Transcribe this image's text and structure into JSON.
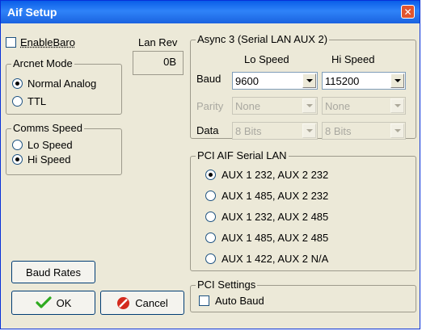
{
  "window": {
    "title": "Aif Setup",
    "close_glyph": "✕"
  },
  "enable_baro": {
    "label": "EnableBaro",
    "checked": false
  },
  "lan_rev": {
    "label": "Lan Rev",
    "value": "0B"
  },
  "arcnet_mode": {
    "legend": "Arcnet Mode",
    "options": [
      {
        "label": "Normal Analog",
        "checked": true
      },
      {
        "label": "TTL",
        "checked": false
      }
    ]
  },
  "comms_speed": {
    "legend": "Comms Speed",
    "options": [
      {
        "label": "Lo Speed",
        "checked": false
      },
      {
        "label": "Hi Speed",
        "checked": true
      }
    ]
  },
  "async3": {
    "legend": "Async 3 (Serial LAN AUX 2)",
    "lo_header": "Lo Speed",
    "hi_header": "Hi Speed",
    "baud": {
      "label": "Baud",
      "lo": "9600",
      "hi": "115200"
    },
    "parity": {
      "label": "Parity",
      "lo": "None",
      "hi": "None"
    },
    "data": {
      "label": "Data",
      "lo": "8 Bits",
      "hi": "8 Bits"
    }
  },
  "pci_aif": {
    "legend": "PCI AIF Serial LAN",
    "options": [
      {
        "label": "AUX 1 232, AUX 2 232",
        "checked": true
      },
      {
        "label": "AUX 1 485, AUX 2 232",
        "checked": false
      },
      {
        "label": "AUX 1 232, AUX 2 485",
        "checked": false
      },
      {
        "label": "AUX 1 485, AUX 2 485",
        "checked": false
      },
      {
        "label": "AUX 1 422, AUX 2 N/A",
        "checked": false
      }
    ]
  },
  "pci_settings": {
    "legend": "PCI Settings",
    "auto_baud": {
      "label": "Auto Baud",
      "checked": false
    }
  },
  "buttons": {
    "baud_rates": "Baud Rates",
    "ok": "OK",
    "cancel": "Cancel"
  },
  "colors": {
    "title_bar": "#0a5ee8",
    "close_button": "#e0552f",
    "dialog_bg": "#ece9d8",
    "ok_check": "#2eaa1f",
    "cancel_icon": "#d42a1e"
  }
}
